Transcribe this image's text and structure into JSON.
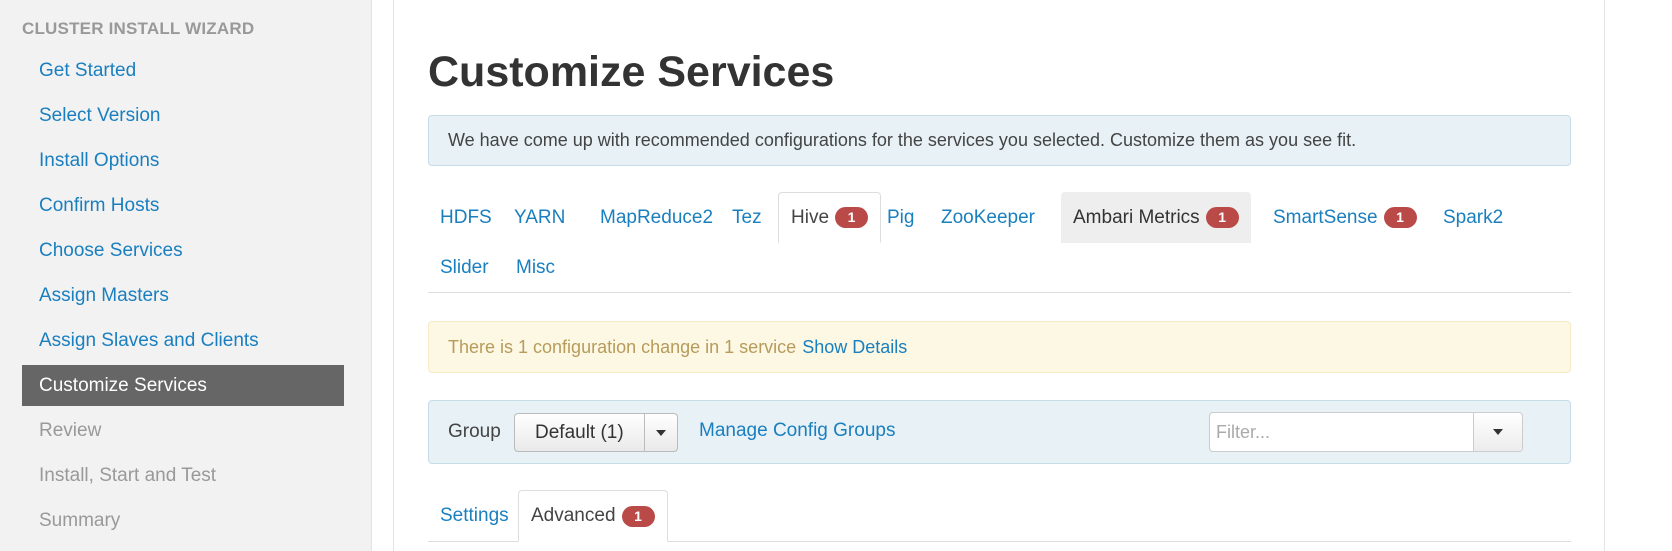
{
  "sidebar": {
    "title": "CLUSTER INSTALL WIZARD",
    "items": [
      {
        "label": "Get Started",
        "state": "link"
      },
      {
        "label": "Select Version",
        "state": "link"
      },
      {
        "label": "Install Options",
        "state": "link"
      },
      {
        "label": "Confirm Hosts",
        "state": "link"
      },
      {
        "label": "Choose Services",
        "state": "link"
      },
      {
        "label": "Assign Masters",
        "state": "link"
      },
      {
        "label": "Assign Slaves and Clients",
        "state": "link"
      },
      {
        "label": "Customize Services",
        "state": "active"
      },
      {
        "label": "Review",
        "state": "disabled"
      },
      {
        "label": "Install, Start and Test",
        "state": "disabled"
      },
      {
        "label": "Summary",
        "state": "disabled"
      }
    ]
  },
  "main": {
    "title": "Customize Services",
    "info_alert": "We have come up with recommended configurations for the services you selected. Customize them as you see fit.",
    "service_tabs": [
      {
        "label": "HDFS",
        "badge": null,
        "state": "normal"
      },
      {
        "label": "YARN",
        "badge": null,
        "state": "normal"
      },
      {
        "label": "MapReduce2",
        "badge": null,
        "state": "normal"
      },
      {
        "label": "Tez",
        "badge": null,
        "state": "normal"
      },
      {
        "label": "Hive",
        "badge": "1",
        "state": "active"
      },
      {
        "label": "Pig",
        "badge": null,
        "state": "normal"
      },
      {
        "label": "ZooKeeper",
        "badge": null,
        "state": "normal"
      },
      {
        "label": "Ambari Metrics",
        "badge": "1",
        "state": "hover"
      },
      {
        "label": "SmartSense",
        "badge": "1",
        "state": "normal"
      },
      {
        "label": "Spark2",
        "badge": null,
        "state": "normal"
      },
      {
        "label": "Slider",
        "badge": null,
        "state": "normal"
      },
      {
        "label": "Misc",
        "badge": null,
        "state": "normal"
      }
    ],
    "warning": {
      "text": "There is 1 configuration change in 1 service",
      "link": "Show Details"
    },
    "group_bar": {
      "label": "Group",
      "selected": "Default (1)",
      "manage_link": "Manage Config Groups",
      "filter_placeholder": "Filter..."
    },
    "sub_tabs": [
      {
        "label": "Settings",
        "badge": null,
        "state": "normal"
      },
      {
        "label": "Advanced",
        "badge": "1",
        "state": "active"
      }
    ]
  },
  "colors": {
    "link": "#1a7fbf",
    "active_nav_bg": "#666666",
    "badge_bg": "#b94a48",
    "info_bg": "#e7f1f6",
    "warning_bg": "#fcf8e3"
  }
}
